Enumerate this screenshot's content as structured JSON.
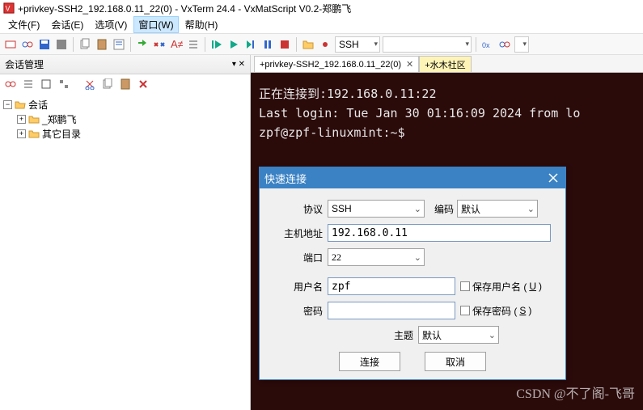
{
  "title": "+privkey-SSH2_192.168.0.11_22(0) - VxTerm 24.4 - VxMatScript V0.2-郑鹏飞",
  "menu": {
    "file": "文件(F)",
    "session": "会话(E)",
    "options": "选项(V)",
    "window": "窗口(W)",
    "help": "帮助(H)"
  },
  "toolbar": {
    "combo_ssh": "SSH"
  },
  "sidebar": {
    "title": "会话管理",
    "root": "会话",
    "node1": "_郑鹏飞",
    "node2": "其它目录"
  },
  "tabs": {
    "t1": "+privkey-SSH2_192.168.0.11_22(0)",
    "t2": "+水木社区"
  },
  "terminal": {
    "l1": "正在连接到:192.168.0.11:22",
    "l2": "Last login: Tue Jan 30 01:16:09 2024 from lo",
    "l3": "zpf@zpf-linuxmint:~$"
  },
  "dialog": {
    "title": "快速连接",
    "lbl_proto": "协议",
    "val_proto": "SSH",
    "lbl_enc": "编码",
    "val_enc": "默认",
    "lbl_host": "主机地址",
    "val_host": "192.168.0.11",
    "lbl_port": "端口",
    "val_port": "22",
    "lbl_user": "用户名",
    "val_user": "zpf",
    "chk_user": "保存用户名 (",
    "chk_user_u": "U",
    "lbl_pass": "密码",
    "chk_pass": "保存密码 (",
    "chk_pass_u": "S",
    "lbl_theme": "主题",
    "val_theme": "默认",
    "btn_ok": "连接",
    "btn_cancel": "取消"
  },
  "watermark": "CSDN @不了阁-飞哥"
}
